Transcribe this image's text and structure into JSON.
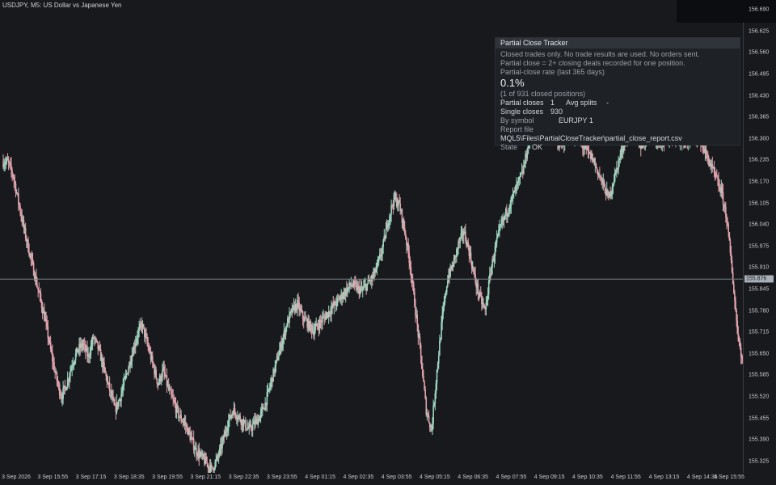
{
  "chart": {
    "title": "USDJPY, M5:  US Dollar vs Japanese Yen",
    "price_ticks": [
      "156.690",
      "156.625",
      "156.560",
      "156.495",
      "156.430",
      "156.365",
      "156.300",
      "156.235",
      "156.170",
      "156.105",
      "156.040",
      "155.975",
      "155.910",
      "155.845",
      "155.780",
      "155.715",
      "155.650",
      "155.585",
      "155.520",
      "155.455",
      "155.390",
      "155.325"
    ],
    "current_price": "155.876",
    "time_ticks": [
      "3 Sep 2026",
      "3 Sep 15:55",
      "3 Sep 17:15",
      "3 Sep 18:35",
      "3 Sep 19:55",
      "3 Sep 21:15",
      "3 Sep 22:35",
      "3 Sep 23:55",
      "4 Sep 01:15",
      "4 Sep 02:35",
      "4 Sep 03:55",
      "4 Sep 05:15",
      "4 Sep 06:35",
      "4 Sep 07:55",
      "4 Sep 09:15",
      "4 Sep 10:35",
      "4 Sep 11:55",
      "4 Sep 13:15",
      "4 Sep 14:35",
      "4 Sep 15:55"
    ],
    "colors": {
      "background": "#17191d",
      "bull": "#9fd4bf",
      "bear": "#e0a3ad",
      "grid": "#2b2e34",
      "crosshair": "#7f858c"
    }
  },
  "chart_data": {
    "type": "candlestick",
    "ylim": [
      155.29,
      156.72
    ],
    "x_start": "3 Sep 2026",
    "x_end": "4 Sep 15:55",
    "current_price": 155.876,
    "series": [
      {
        "close": [
          156.23,
          156.19,
          156.11,
          156.03,
          155.96,
          155.89,
          155.82,
          155.75,
          155.66,
          155.58,
          155.52,
          155.56,
          155.62,
          155.66,
          155.68,
          155.64,
          155.7,
          155.66,
          155.6,
          155.54,
          155.48,
          155.52,
          155.58,
          155.64,
          155.7,
          155.74,
          155.68,
          155.62,
          155.56,
          155.6,
          155.54,
          155.5,
          155.46,
          155.44,
          155.4,
          155.36,
          155.34,
          155.32,
          155.3,
          155.33,
          155.38,
          155.44,
          155.48,
          155.46,
          155.44,
          155.42,
          155.44,
          155.46,
          155.5,
          155.56,
          155.62,
          155.68,
          155.74,
          155.78,
          155.8,
          155.76,
          155.74,
          155.72,
          155.74,
          155.76,
          155.78,
          155.8,
          155.82,
          155.84,
          155.86,
          155.85,
          155.84,
          155.86,
          155.88,
          155.92,
          155.98,
          156.06,
          156.12,
          156.1,
          156.02,
          155.92,
          155.78,
          155.64,
          155.48,
          155.42,
          155.6,
          155.76,
          155.88,
          155.92,
          155.98,
          156.02,
          155.96,
          155.88,
          155.82,
          155.78,
          155.9,
          155.98,
          156.04,
          156.08,
          156.12,
          156.16,
          156.2,
          156.28,
          156.36,
          156.4,
          156.38,
          156.34,
          156.3,
          156.28,
          156.3,
          156.32,
          156.3,
          156.28,
          156.26,
          156.24,
          156.2,
          156.16,
          156.12,
          156.18,
          156.24,
          156.3,
          156.32,
          156.3,
          156.28,
          156.3,
          156.32,
          156.3,
          156.29,
          156.3,
          156.31,
          156.3,
          156.28,
          156.3,
          156.32,
          156.3,
          156.26,
          156.22,
          156.18,
          156.14,
          156.06,
          155.9,
          155.72,
          155.62
        ]
      }
    ]
  },
  "panel": {
    "title": "Partial Close Tracker",
    "line1": "Closed trades only. No trade results are used. No orders sent.",
    "line2": "Partial close = 2+ closing deals recorded for one position.",
    "line3": "Partial-close rate (last 365 days)",
    "rate": "0.1%",
    "rate_note": "(1 of 931 closed positions)",
    "partial_closes_label": "Partial closes",
    "partial_closes_value": "1",
    "avg_splits_label": "Avg splits",
    "avg_splits_value": "-",
    "single_closes_label": "Single closes",
    "single_closes_value": "930",
    "by_symbol_label": "By symbol",
    "by_symbol_value": "EURJPY 1",
    "report_file_label": "Report file",
    "report_file_value": "MQL5\\Files\\PartialCloseTracker\\partial_close_report.csv",
    "state_label": "State",
    "state_value": "OK"
  }
}
